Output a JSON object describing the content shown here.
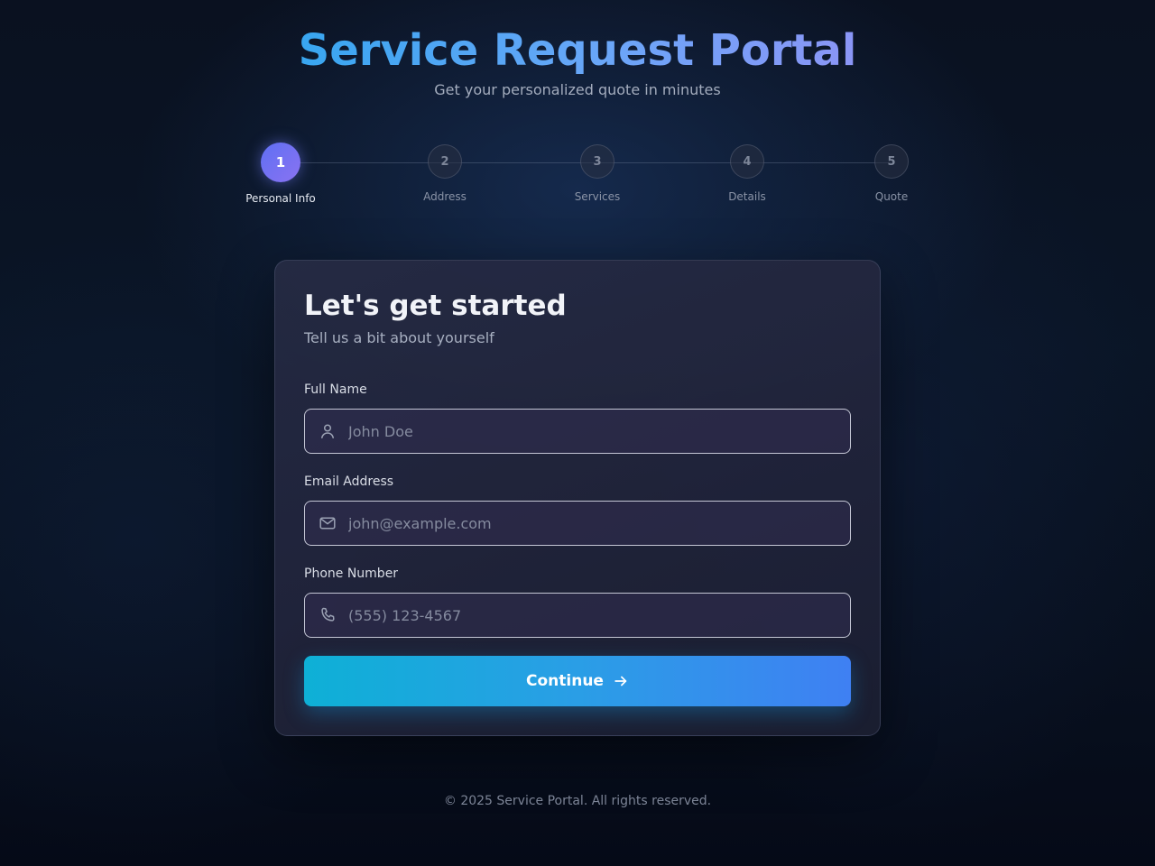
{
  "header": {
    "title": "Service Request Portal",
    "subtitle": "Get your personalized quote in minutes"
  },
  "stepper": {
    "current_step": 1,
    "steps": [
      {
        "number": "1",
        "label": "Personal Info"
      },
      {
        "number": "2",
        "label": "Address"
      },
      {
        "number": "3",
        "label": "Services"
      },
      {
        "number": "4",
        "label": "Details"
      },
      {
        "number": "5",
        "label": "Quote"
      }
    ]
  },
  "form": {
    "title": "Let's get started",
    "subtitle": "Tell us a bit about yourself",
    "fields": [
      {
        "label": "Full Name",
        "icon": "user-icon",
        "placeholder": "John Doe",
        "value": ""
      },
      {
        "label": "Email Address",
        "icon": "mail-icon",
        "placeholder": "john@example.com",
        "value": ""
      },
      {
        "label": "Phone Number",
        "icon": "phone-icon",
        "placeholder": "(555) 123-4567",
        "value": ""
      }
    ],
    "continue_label": "Continue",
    "continue_icon": "arrow-right-icon"
  },
  "footer": {
    "text": "© 2025 Service Portal. All rights reserved."
  },
  "colors": {
    "background": "#0a1120",
    "active_step": "#6c72f3",
    "button_start": "#0eb0d6",
    "button_end": "#3f80f3",
    "title_gradient_start": "#38a6f0",
    "title_gradient_end": "#8b95f6"
  }
}
